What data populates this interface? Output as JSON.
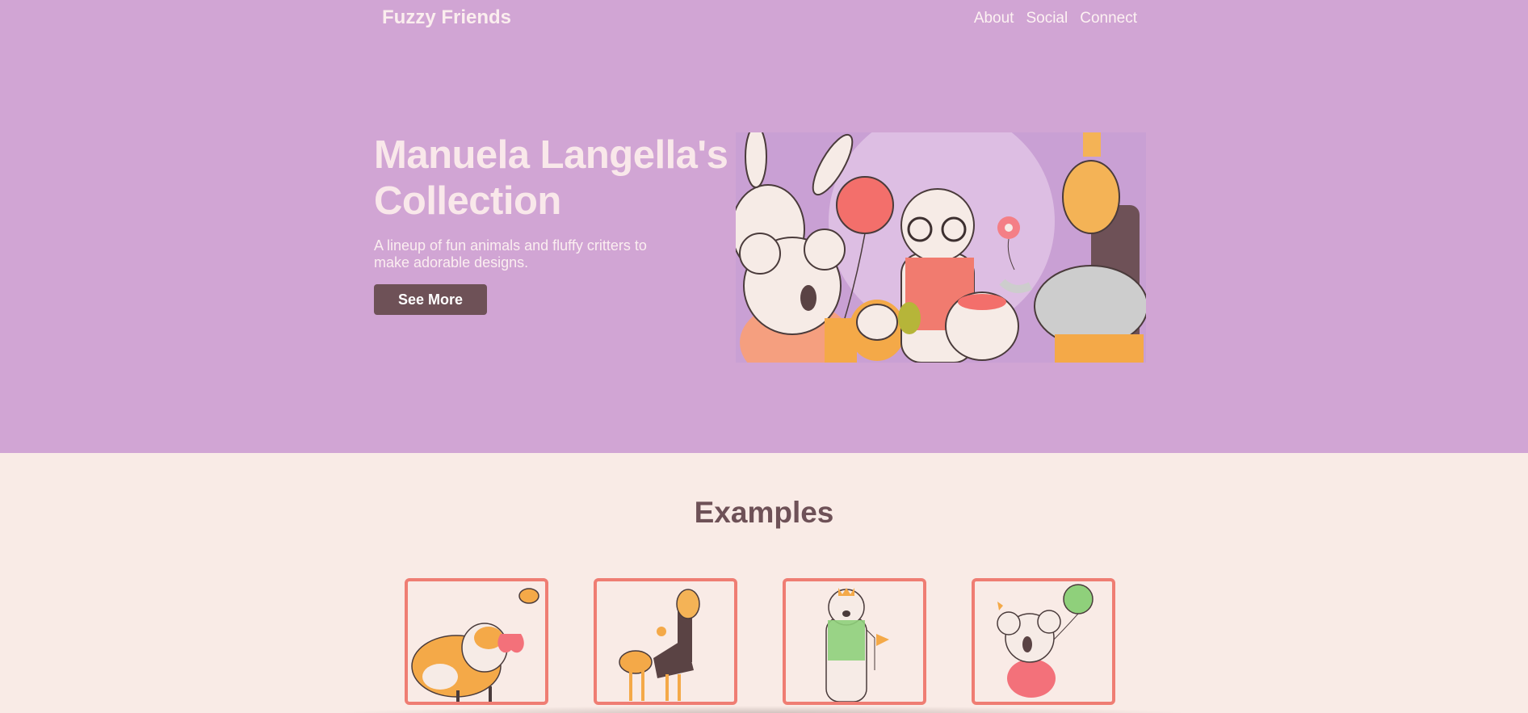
{
  "header": {
    "brand": "Fuzzy Friends",
    "nav": [
      "About",
      "Social",
      "Connect"
    ]
  },
  "hero": {
    "title": "Manuela Langella's Collection",
    "subtitle": "A lineup of fun animals and fluffy critters to make adorable designs.",
    "cta_label": "See More"
  },
  "examples": {
    "title": "Examples",
    "cards": [
      {
        "icon": "fox-illustration-icon"
      },
      {
        "icon": "giraffe-illustration-icon"
      },
      {
        "icon": "polar-bear-illustration-icon"
      },
      {
        "icon": "koala-illustration-icon"
      }
    ]
  },
  "colors": {
    "hero_bg": "#d1a5d4",
    "page_bg": "#f9ebe6",
    "accent": "#ef7d73",
    "button": "#6e5157"
  }
}
